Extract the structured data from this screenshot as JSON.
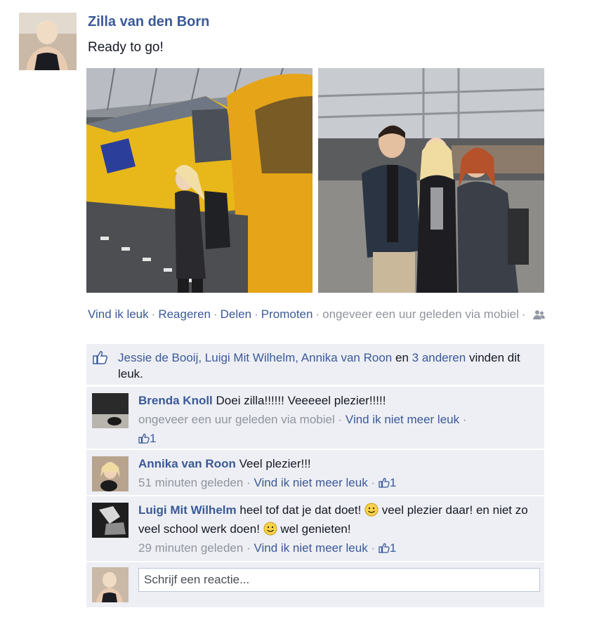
{
  "post": {
    "author": "Zilla van den Born",
    "text": "Ready to go!"
  },
  "actions": {
    "like": "Vind ik leuk",
    "comment": "Reageren",
    "share": "Delen",
    "promote": "Promoten",
    "timestamp": "ongeveer een uur geleden via mobiel",
    "sep": "·",
    "audience_icon": "friends-icon"
  },
  "likes": {
    "names": "Jessie de Booij, Luigi Mit Wilhelm, Annika van Roon",
    "connector": "en",
    "others": "3 anderen",
    "suffix": "vinden dit leuk."
  },
  "comments": [
    {
      "author": "Brenda Knoll",
      "text": "Doei zilla!!!!!! Veeeeel plezier!!!!!",
      "time": "ongeveer een uur geleden via mobiel",
      "unlike": "Vind ik niet meer leuk",
      "likes": "1"
    },
    {
      "author": "Annika van Roon",
      "text": "Veel plezier!!!",
      "time": "51 minuten geleden",
      "unlike": "Vind ik niet meer leuk",
      "likes": "1"
    },
    {
      "author": "Luigi Mit Wilhelm",
      "text_1": "heel tof dat je dat doet!",
      "text_2": "veel plezier daar! en niet zo veel school werk doen!",
      "text_3": "wel genieten!",
      "time": "29 minuten geleden",
      "unlike": "Vind ik niet meer leuk",
      "likes": "1"
    }
  ],
  "reply": {
    "placeholder": "Schrijf een reactie..."
  },
  "colors": {
    "link": "#3b5998",
    "feedback_bg": "#edeff4",
    "meta": "#90949c"
  }
}
